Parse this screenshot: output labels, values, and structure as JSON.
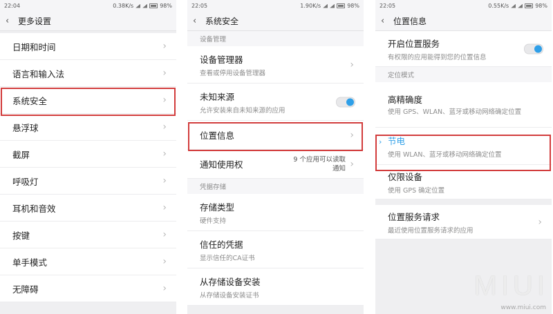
{
  "panel1": {
    "status": {
      "time": "22:04",
      "speed": "0.38K/s",
      "battery": "98%"
    },
    "title": "更多设置",
    "items": [
      {
        "label": "日期和时间"
      },
      {
        "label": "语言和输入法"
      },
      {
        "label": "系统安全"
      },
      {
        "label": "悬浮球"
      },
      {
        "label": "截屏"
      },
      {
        "label": "呼吸灯"
      },
      {
        "label": "耳机和音效"
      },
      {
        "label": "按键"
      },
      {
        "label": "单手模式"
      },
      {
        "label": "无障碍"
      }
    ]
  },
  "panel2": {
    "status": {
      "time": "22:05",
      "speed": "1.90K/s",
      "battery": "98%"
    },
    "title": "系统安全",
    "section1": "设备管理",
    "device_admin": {
      "label": "设备管理器",
      "sub": "查看或停用设备管理器"
    },
    "unknown_sources": {
      "label": "未知来源",
      "sub": "允许安装来自未知来源的应用"
    },
    "location": {
      "label": "位置信息"
    },
    "notification_access": {
      "label": "通知使用权",
      "value_line1": "9 个应用可以读取",
      "value_line2": "通知"
    },
    "section2": "凭据存储",
    "storage_type": {
      "label": "存储类型",
      "sub": "硬件支持"
    },
    "trusted_creds": {
      "label": "信任的凭据",
      "sub": "显示信任的CA证书"
    },
    "install_from_storage": {
      "label": "从存储设备安装",
      "sub": "从存储设备安装证书"
    }
  },
  "panel3": {
    "status": {
      "time": "22:05",
      "speed": "0.55K/s",
      "battery": "98%"
    },
    "title": "位置信息",
    "location_service": {
      "label": "开启位置服务",
      "sub": "有权限的应用能得到您的位置信息"
    },
    "section_mode": "定位模式",
    "high_accuracy": {
      "label": "高精确度",
      "sub": "使用 GPS、WLAN、蓝牙或移动网络确定位置"
    },
    "battery_saving": {
      "label": "节电",
      "sub": "使用 WLAN、蓝牙或移动网络确定位置"
    },
    "device_only": {
      "label": "仅限设备",
      "sub": "使用 GPS 确定位置"
    },
    "requests": {
      "label": "位置服务请求",
      "sub": "最近使用位置服务请求的应用"
    }
  },
  "watermark": {
    "logo": "MIUI",
    "url": "www.miui.com"
  },
  "colors": {
    "highlight": "#d23b3b",
    "accent": "#2e9fe8"
  }
}
